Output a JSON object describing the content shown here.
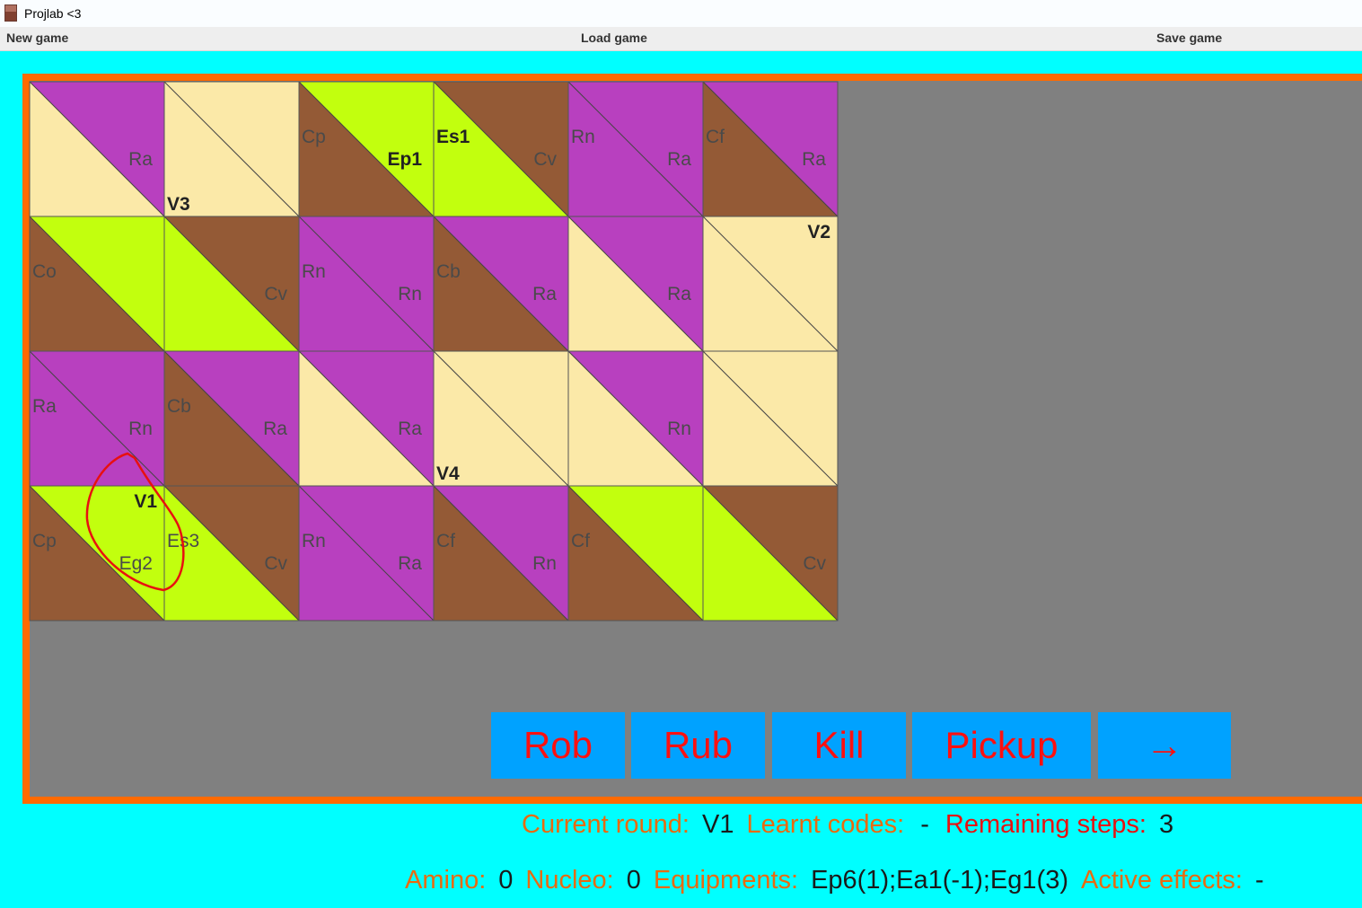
{
  "window": {
    "title": "Projlab <3",
    "icon": "app-icon"
  },
  "menu": {
    "new_game": "New game",
    "load_game": "Load game",
    "save_game": "Save game"
  },
  "colors": {
    "background": "#00FFFF",
    "frame": "#FF6A00",
    "board_bg": "#808080",
    "purple": "#B840BF",
    "yellow": "#FBE9A8",
    "green": "#C2FF0E",
    "brown": "#945A36",
    "button_bg": "#00A2FF",
    "button_text": "#FF1010",
    "label_orange": "#E86A10",
    "label_red": "#E81010"
  },
  "grid": {
    "rows": [
      [
        {
          "tr": "purple",
          "bl": "yellow",
          "codes": [
            {
              "t": "Ra",
              "pos": "r",
              "c": "grey"
            }
          ]
        },
        {
          "tr": "yellow",
          "bl": "yellow",
          "codes": [
            {
              "t": "V3",
              "pos": "bl",
              "c": "dark"
            }
          ]
        },
        {
          "tr": "green",
          "bl": "brown",
          "codes": [
            {
              "t": "Cp",
              "pos": "l",
              "c": "grey"
            },
            {
              "t": "Ep1",
              "pos": "r",
              "c": "dark"
            }
          ]
        },
        {
          "tr": "brown",
          "bl": "green",
          "codes": [
            {
              "t": "Es1",
              "pos": "l",
              "c": "dark"
            },
            {
              "t": "Cv",
              "pos": "r",
              "c": "grey"
            }
          ]
        },
        {
          "tr": "purple",
          "bl": "purple",
          "codes": [
            {
              "t": "Rn",
              "pos": "l",
              "c": "grey"
            },
            {
              "t": "Ra",
              "pos": "r",
              "c": "grey"
            }
          ]
        },
        {
          "tr": "purple",
          "bl": "brown",
          "codes": [
            {
              "t": "Cf",
              "pos": "l",
              "c": "grey"
            },
            {
              "t": "Ra",
              "pos": "r",
              "c": "grey"
            }
          ]
        }
      ],
      [
        {
          "tr": "green",
          "bl": "brown",
          "codes": [
            {
              "t": "Co",
              "pos": "l",
              "c": "grey"
            }
          ]
        },
        {
          "tr": "brown",
          "bl": "green",
          "codes": [
            {
              "t": "Cv",
              "pos": "r",
              "c": "grey"
            }
          ]
        },
        {
          "tr": "purple",
          "bl": "purple",
          "codes": [
            {
              "t": "Rn",
              "pos": "l",
              "c": "grey"
            },
            {
              "t": "Rn",
              "pos": "r",
              "c": "grey"
            }
          ]
        },
        {
          "tr": "purple",
          "bl": "brown",
          "codes": [
            {
              "t": "Cb",
              "pos": "l",
              "c": "grey"
            },
            {
              "t": "Ra",
              "pos": "r",
              "c": "grey"
            }
          ]
        },
        {
          "tr": "purple",
          "bl": "yellow",
          "codes": [
            {
              "t": "Ra",
              "pos": "r",
              "c": "grey"
            }
          ]
        },
        {
          "tr": "yellow",
          "bl": "yellow",
          "codes": [
            {
              "t": "V2",
              "pos": "tr",
              "c": "dark"
            }
          ]
        }
      ],
      [
        {
          "tr": "purple",
          "bl": "purple",
          "codes": [
            {
              "t": "Ra",
              "pos": "l",
              "c": "grey"
            },
            {
              "t": "Rn",
              "pos": "r",
              "c": "grey"
            }
          ]
        },
        {
          "tr": "purple",
          "bl": "brown",
          "codes": [
            {
              "t": "Cb",
              "pos": "l",
              "c": "grey"
            },
            {
              "t": "Ra",
              "pos": "r",
              "c": "grey"
            }
          ]
        },
        {
          "tr": "purple",
          "bl": "yellow",
          "codes": [
            {
              "t": "Ra",
              "pos": "r",
              "c": "grey"
            }
          ]
        },
        {
          "tr": "yellow",
          "bl": "yellow",
          "codes": [
            {
              "t": "V4",
              "pos": "bl",
              "c": "dark"
            }
          ]
        },
        {
          "tr": "purple",
          "bl": "yellow",
          "codes": [
            {
              "t": "Rn",
              "pos": "r",
              "c": "grey"
            }
          ]
        },
        {
          "tr": "yellow",
          "bl": "yellow",
          "codes": []
        }
      ],
      [
        {
          "tr": "green",
          "bl": "brown",
          "codes": [
            {
              "t": "V1",
              "pos": "tr",
              "c": "dark"
            },
            {
              "t": "Cp",
              "pos": "l",
              "c": "grey"
            },
            {
              "t": "Eg2",
              "pos": "r",
              "c": "grey"
            }
          ]
        },
        {
          "tr": "brown",
          "bl": "green",
          "codes": [
            {
              "t": "Es3",
              "pos": "l",
              "c": "grey"
            },
            {
              "t": "Cv",
              "pos": "r",
              "c": "grey"
            }
          ]
        },
        {
          "tr": "purple",
          "bl": "purple",
          "codes": [
            {
              "t": "Rn",
              "pos": "l",
              "c": "grey"
            },
            {
              "t": "Ra",
              "pos": "r",
              "c": "grey"
            }
          ]
        },
        {
          "tr": "purple",
          "bl": "brown",
          "codes": [
            {
              "t": "Cf",
              "pos": "l",
              "c": "grey"
            },
            {
              "t": "Rn",
              "pos": "r",
              "c": "grey"
            }
          ]
        },
        {
          "tr": "green",
          "bl": "brown",
          "codes": [
            {
              "t": "Cf",
              "pos": "l",
              "c": "grey"
            }
          ]
        },
        {
          "tr": "brown",
          "bl": "green",
          "codes": [
            {
              "t": "Cv",
              "pos": "r",
              "c": "grey"
            }
          ]
        }
      ]
    ]
  },
  "actions": {
    "rob": "Rob",
    "rub": "Rub",
    "kill": "Kill",
    "pickup": "Pickup",
    "next": "→"
  },
  "status": {
    "current_round_label": "Current round:",
    "current_round": "V1",
    "learnt_codes_label": "Learnt codes:",
    "learnt_codes": "-",
    "remaining_steps_label": "Remaining steps:",
    "remaining_steps": "3",
    "amino_label": "Amino:",
    "amino": "0",
    "nucleo_label": "Nucleo:",
    "nucleo": "0",
    "equipments_label": "Equipments:",
    "equipments": "Ep6(1);Ea1(-1);Eg1(3)",
    "active_effects_label": "Active effects:",
    "active_effects": "-"
  }
}
